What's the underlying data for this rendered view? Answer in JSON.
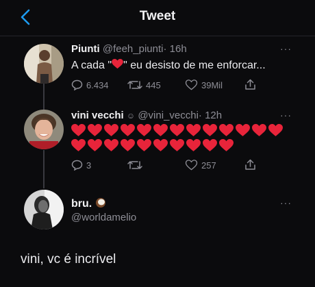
{
  "header": {
    "title": "Tweet"
  },
  "tweets": [
    {
      "name": "Piunti",
      "handle": "@feeh_piunti",
      "time": "· 16h",
      "text_before": "A cada \"",
      "text_after": "\" eu desisto de me enforcar...",
      "reply_count": "6.434",
      "retweet_count": "445",
      "like_count": "39Mil"
    },
    {
      "name": "vini vecchi",
      "badge_icon": "emoji-icon",
      "handle": "@vini_vecchi",
      "time": "· 12h",
      "heart_count_row1": 13,
      "heart_count_row2": 10,
      "reply_count": "3",
      "retweet_count": "",
      "like_count": "257"
    }
  ],
  "reply": {
    "name": "bru.",
    "badge_icon": "coconut-icon",
    "handle": "@worldamelio",
    "text": "vini, vc é incrível"
  },
  "more_label": "···",
  "colors": {
    "heart": "#e8243a",
    "accent": "#1d9bf0",
    "muted": "#8e8e96",
    "background": "#0b0b0d"
  }
}
